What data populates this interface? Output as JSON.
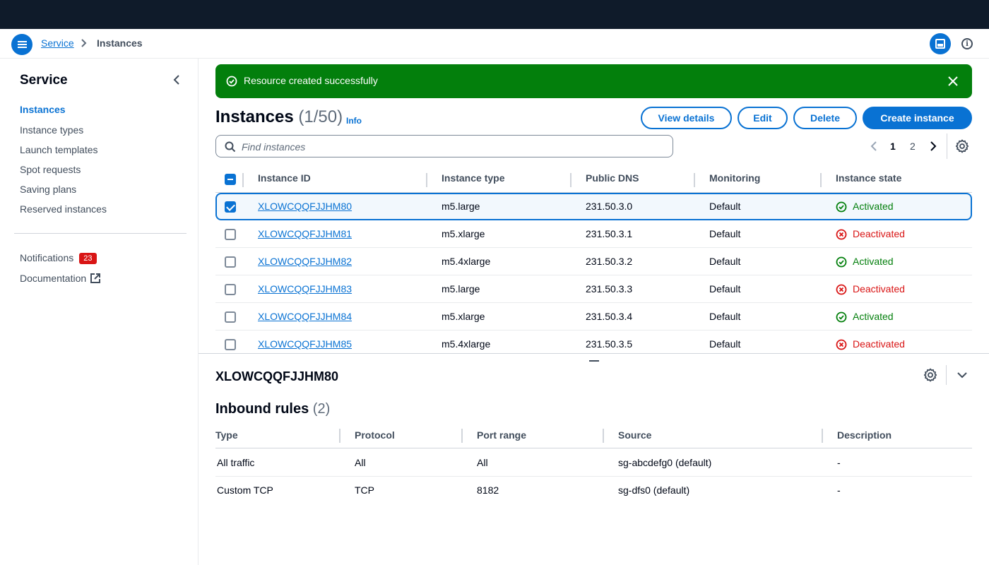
{
  "breadcrumb": {
    "service": "Service",
    "current": "Instances"
  },
  "sidebar": {
    "title": "Service",
    "items": [
      {
        "label": "Instances",
        "active": true
      },
      {
        "label": "Instance types"
      },
      {
        "label": "Launch templates"
      },
      {
        "label": "Spot requests"
      },
      {
        "label": "Saving plans"
      },
      {
        "label": "Reserved instances"
      }
    ],
    "notifications": {
      "label": "Notifications",
      "count": "23"
    },
    "documentation": "Documentation"
  },
  "flash": {
    "message": "Resource created successfully",
    "color": "#037f0c"
  },
  "header": {
    "title": "Instances",
    "count": "(1/50)",
    "info": "Info"
  },
  "actions": {
    "view_details": "View details",
    "edit": "Edit",
    "delete": "Delete",
    "create": "Create instance"
  },
  "search": {
    "placeholder": "Find instances",
    "value": ""
  },
  "pagination": {
    "current": "1",
    "next_page": "2"
  },
  "table": {
    "columns": [
      "Instance ID",
      "Instance type",
      "Public DNS",
      "Monitoring",
      "Instance state"
    ],
    "rows": [
      {
        "id": "XLOWCQQFJJHM80",
        "type": "m5.large",
        "dns": "231.50.3.0",
        "monitoring": "Default",
        "state": "Activated",
        "selected": true
      },
      {
        "id": "XLOWCQQFJJHM81",
        "type": "m5.xlarge",
        "dns": "231.50.3.1",
        "monitoring": "Default",
        "state": "Deactivated"
      },
      {
        "id": "XLOWCQQFJJHM82",
        "type": "m5.4xlarge",
        "dns": "231.50.3.2",
        "monitoring": "Default",
        "state": "Activated"
      },
      {
        "id": "XLOWCQQFJJHM83",
        "type": "m5.large",
        "dns": "231.50.3.3",
        "monitoring": "Default",
        "state": "Deactivated"
      },
      {
        "id": "XLOWCQQFJJHM84",
        "type": "m5.xlarge",
        "dns": "231.50.3.4",
        "monitoring": "Default",
        "state": "Activated"
      },
      {
        "id": "XLOWCQQFJJHM85",
        "type": "m5.4xlarge",
        "dns": "231.50.3.5",
        "monitoring": "Default",
        "state": "Deactivated"
      }
    ]
  },
  "split_panel": {
    "title": "XLOWCQQFJJHM80",
    "section_title": "Inbound rules",
    "section_count": "(2)",
    "columns": [
      "Type",
      "Protocol",
      "Port range",
      "Source",
      "Description"
    ],
    "rows": [
      [
        "All traffic",
        "All",
        "All",
        "sg-abcdefg0 (default)",
        "-"
      ],
      [
        "Custom TCP",
        "TCP",
        "8182",
        "sg-dfs0 (default)",
        "-"
      ]
    ]
  },
  "colors": {
    "accent": "#0972d3",
    "success": "#037f0c",
    "error": "#d91515",
    "topbar": "#0f1b2a"
  },
  "icons": {
    "menu": "menu-icon",
    "chevron": "chevron-right-icon",
    "split": "split-panel-icon",
    "info": "info-icon",
    "collapse": "chevron-left-icon",
    "external": "external-link-icon",
    "success": "check-circle-icon",
    "close": "close-icon",
    "search": "search-icon",
    "settings": "gear-icon",
    "error": "x-circle-icon"
  }
}
